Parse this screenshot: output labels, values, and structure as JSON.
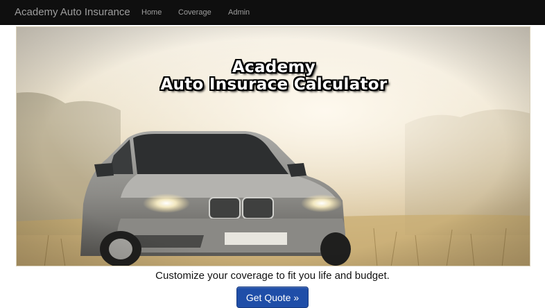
{
  "navbar": {
    "brand": "Academy Auto Insurance",
    "links": [
      "Home",
      "Coverage",
      "Admin"
    ]
  },
  "hero": {
    "title_line1": "Academy",
    "title_line2": "Auto Insurace Calculator"
  },
  "tagline": "Customize your coverage to fit you life and budget.",
  "cta": {
    "label": "Get Quote »",
    "color": "#1f4ea8"
  }
}
